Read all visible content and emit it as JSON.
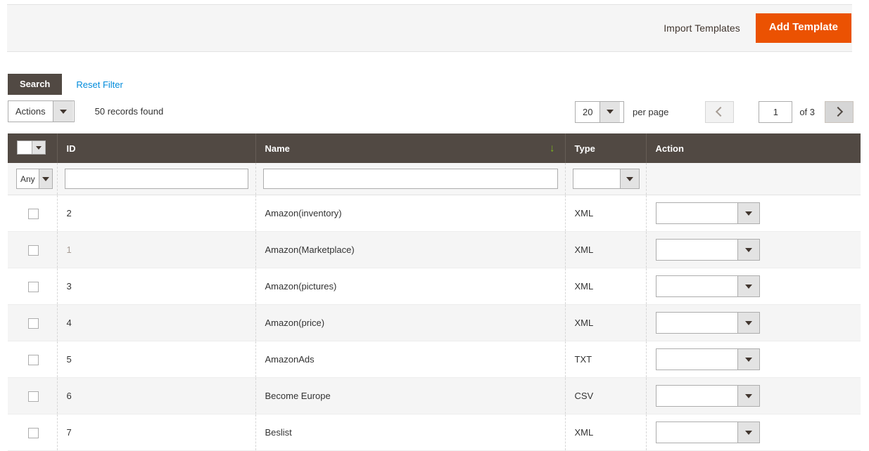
{
  "toolbar": {
    "import_templates_label": "Import Templates",
    "add_template_label": "Add Template",
    "primary_color": "#eb5202"
  },
  "grid_actions": {
    "search_label": "Search",
    "reset_filter_label": "Reset Filter",
    "actions_select_value": "Actions",
    "records_found": "50 records found"
  },
  "pager": {
    "limit_value": "20",
    "per_page_label": "per page",
    "prev_icon": "chevron-left-icon",
    "next_icon": "chevron-right-icon",
    "current_page": "1",
    "of_label": "of 3"
  },
  "grid": {
    "columns": [
      {
        "key": "check",
        "label": ""
      },
      {
        "key": "id",
        "label": "ID"
      },
      {
        "key": "name",
        "label": "Name"
      },
      {
        "key": "type",
        "label": "Type"
      },
      {
        "key": "action",
        "label": "Action"
      }
    ],
    "sort": {
      "column": "Name",
      "direction": "desc",
      "arrow": "↓",
      "color": "#7db61c"
    },
    "filters": {
      "check_select_value": "Any",
      "id_value": "",
      "id_placeholder": "",
      "name_value": "",
      "name_placeholder": "",
      "type_value": ""
    },
    "rows": [
      {
        "id": "2",
        "name": "Amazon(inventory)",
        "type": "XML",
        "action": "",
        "highlight": false
      },
      {
        "id": "1",
        "name": "Amazon(Marketplace)",
        "type": "XML",
        "action": "",
        "highlight": true
      },
      {
        "id": "3",
        "name": "Amazon(pictures)",
        "type": "XML",
        "action": "",
        "highlight": false
      },
      {
        "id": "4",
        "name": "Amazon(price)",
        "type": "XML",
        "action": "",
        "highlight": false
      },
      {
        "id": "5",
        "name": "AmazonAds",
        "type": "TXT",
        "action": "",
        "highlight": false
      },
      {
        "id": "6",
        "name": "Become Europe",
        "type": "CSV",
        "action": "",
        "highlight": false
      },
      {
        "id": "7",
        "name": "Beslist",
        "type": "XML",
        "action": "",
        "highlight": false
      }
    ]
  }
}
